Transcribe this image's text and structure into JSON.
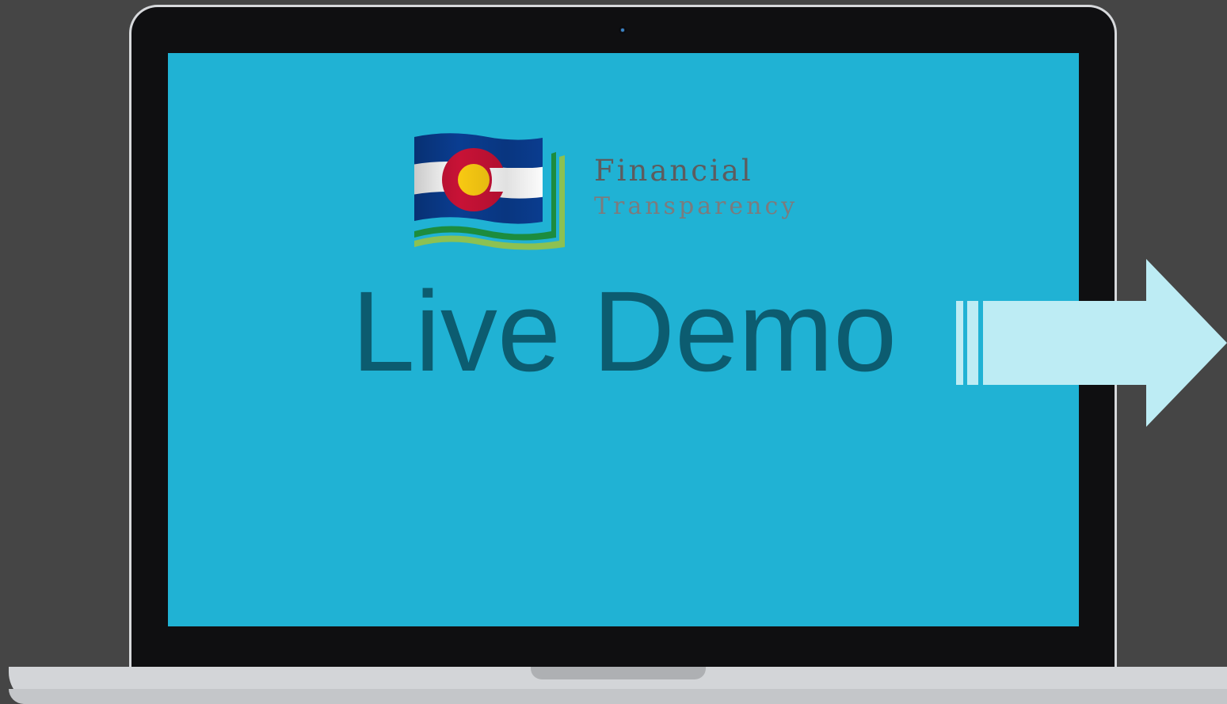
{
  "logo": {
    "word_1": "Financial",
    "word_2": "Transparency",
    "flag_colors": {
      "blue": "#0a3d91",
      "white": "#ffffff",
      "red": "#c81236",
      "gold": "#f8c912",
      "green_dark": "#1c8c3e",
      "green_light": "#8cc152"
    }
  },
  "headline": "Live Demo",
  "icons": {
    "next_arrow": "arrow-right-icon",
    "camera": "camera-icon"
  },
  "colors": {
    "background": "#454545",
    "screen": "#20b2d4",
    "headline_text": "#0c5c70",
    "arrow_fill": "#bdecf4"
  }
}
